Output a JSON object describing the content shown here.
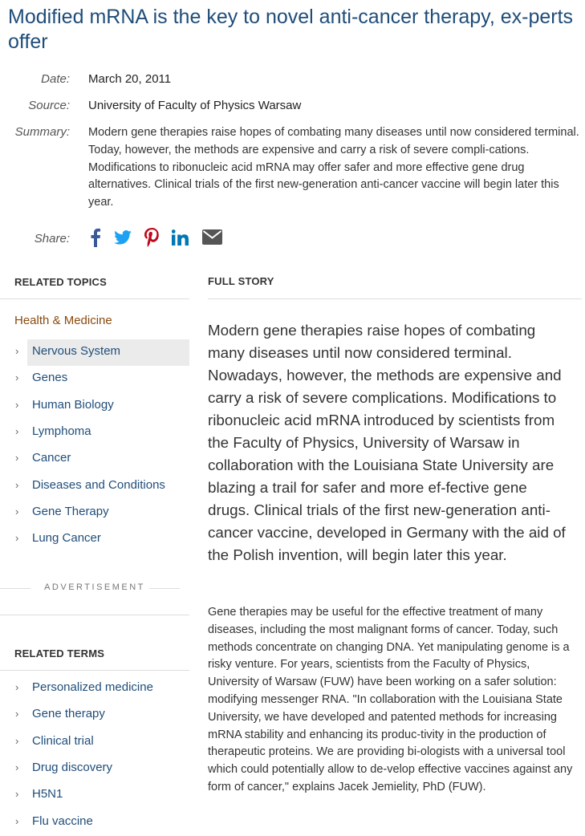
{
  "article": {
    "title": "Modified mRNA is the key to novel anti-cancer therapy, ex-perts offer",
    "date_label": "Date:",
    "date": "March 20, 2011",
    "source_label": "Source:",
    "source": "University of Faculty of Physics Warsaw",
    "summary_label": "Summary:",
    "summary": "Modern gene therapies raise hopes of combating many diseases until now considered terminal. Today, however, the methods are expensive and carry a risk of severe compli-cations. Modifications to ribonucleic acid mRNA may offer safer and more effective gene drug alternatives. Clinical trials of the first new-generation anti-cancer vaccine will begin later this year.",
    "share_label": "Share:"
  },
  "share_icons": [
    "facebook-icon",
    "twitter-icon",
    "pinterest-icon",
    "linkedin-icon",
    "email-icon"
  ],
  "colors": {
    "title": "#1f4d7a",
    "link": "#1f4d7a",
    "category": "#8a4a0e",
    "facebook": "#3b5998",
    "twitter": "#1da1f2",
    "pinterest": "#bd081c",
    "linkedin": "#0077b5",
    "email": "#555555"
  },
  "related_topics": {
    "heading": "RELATED TOPICS",
    "category": "Health & Medicine",
    "items": [
      "Nervous System",
      "Genes",
      "Human Biology",
      "Lymphoma",
      "Cancer",
      "Diseases and Conditions",
      "Gene Therapy",
      "Lung Cancer"
    ],
    "highlighted_index": 0
  },
  "advertisement": "ADVERTISEMENT",
  "related_terms": {
    "heading": "RELATED TERMS",
    "items": [
      "Personalized medicine",
      "Gene therapy",
      "Clinical trial",
      "Drug discovery",
      "H5N1",
      "Flu vaccine"
    ]
  },
  "full_story": {
    "heading": "FULL STORY",
    "lead": "Modern gene therapies raise hopes of combating many diseases until now considered terminal. Nowadays, however, the methods are expensive and carry a risk of severe complications. Modifications to ribonucleic acid mRNA introduced by scientists from the Faculty of Physics, University of Warsaw in collaboration with the Louisiana State University are blazing a trail for safer and more ef-fective gene drugs. Clinical trials of the first new-generation anti-cancer vaccine, developed in Germany with the aid of the Polish invention, will begin later this year.",
    "body": "Gene therapies may be useful for the effective treatment of many diseases, including the most malignant forms of cancer. Today, such methods concentrate on changing DNA. Yet manipulating genome is a risky venture. For years, scientists from the Faculty of Physics, University of Warsaw (FUW) have been working on a safer solution: modifying messenger RNA. \"In collaboration with the Louisiana State University, we have developed and patented methods for increasing mRNA stability and enhancing its produc-tivity in the production of therapeutic proteins. We are providing bi-ologists with a universal tool which could potentially allow to de-velop effective vaccines against any form of cancer,\" explains Jacek Jemielity, PhD (FUW)."
  }
}
